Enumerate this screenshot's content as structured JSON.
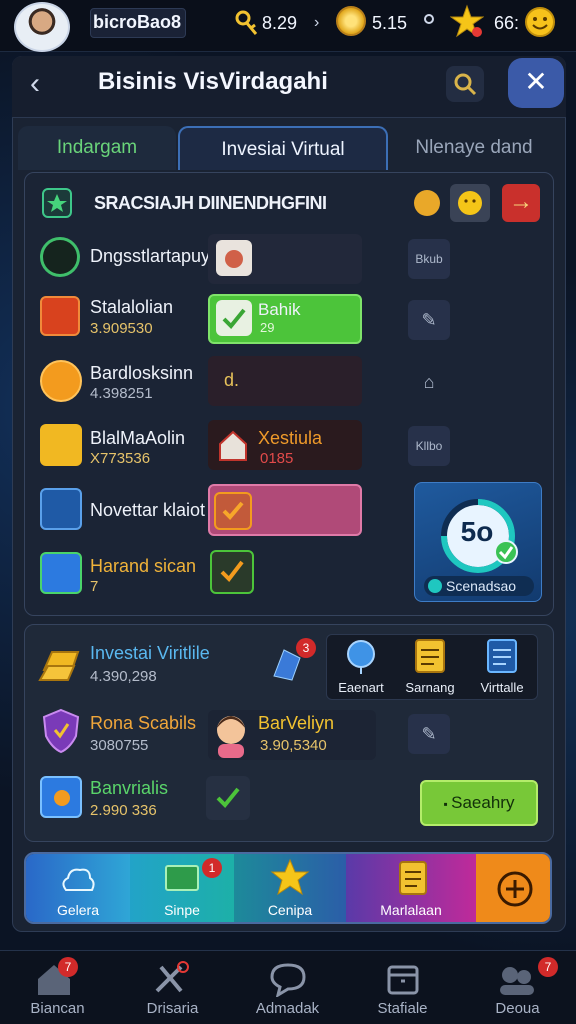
{
  "topbar": {
    "username": "bicroBao8",
    "stats": [
      {
        "icon": "key-icon",
        "value": "8.29"
      },
      {
        "icon": "gold-coin-icon",
        "value": "5.15"
      },
      {
        "icon": "star-icon",
        "value": "66:"
      }
    ]
  },
  "header": {
    "title": "Bisinis VisVirdagahi"
  },
  "tabs": [
    {
      "label": "Indargam"
    },
    {
      "label": "Invesiai Virtual"
    },
    {
      "label": "Nlenaye dand"
    }
  ],
  "section1": {
    "heading": "SRACSIAJH DIINENDHGFINI",
    "rows": [
      {
        "name": "Dngsstlartapuy",
        "value": ""
      },
      {
        "name": "Stalalolian",
        "value": "3.909530",
        "badge": "Bahik",
        "badge_sub": "29"
      },
      {
        "name": "Bardlosksinn",
        "value": "4.398251",
        "badge": "d."
      },
      {
        "name": "BlalMaAolin",
        "value": "X773536",
        "badge": "Xestiula",
        "badge_sub": "0185"
      },
      {
        "name": "Novettar klaiot",
        "value": ""
      },
      {
        "name": "Harand sican",
        "value": "7"
      }
    ],
    "side_labels": [
      "Bkub",
      "Kllbo"
    ],
    "progress_value": "5o",
    "progress_label": "Scenadsao"
  },
  "section2": {
    "rows": [
      {
        "name": "Investai Viritlile",
        "value": "4.390,298"
      },
      {
        "name": "Rona Scabils",
        "value": "3080755"
      },
      {
        "name": "Banvrialis",
        "value": "2.990 336"
      }
    ],
    "agent": {
      "name": "BarVeliyn",
      "value": "3.90,5340"
    },
    "quick_actions": [
      "Eaenart",
      "Sarnang",
      "Virttalle"
    ],
    "badge_count": "3",
    "action_button": "Saeahry"
  },
  "color_bar": [
    {
      "label": "Gelera",
      "color": "#2a68c8"
    },
    {
      "label": "Sinpe",
      "color": "#1fa7b9"
    },
    {
      "label": "Cenipa",
      "color": "#2d6aa8"
    },
    {
      "label": "Marlalaan",
      "color": "#8c2bb8"
    },
    {
      "label": "",
      "color": "#ef8a1a"
    }
  ],
  "nav": [
    {
      "label": "Biancan",
      "badge": "7"
    },
    {
      "label": "Drisaria",
      "badge": ""
    },
    {
      "label": "Admadak",
      "badge": ""
    },
    {
      "label": "Stafiale",
      "badge": ""
    },
    {
      "label": "Deoua",
      "badge": "7"
    }
  ]
}
